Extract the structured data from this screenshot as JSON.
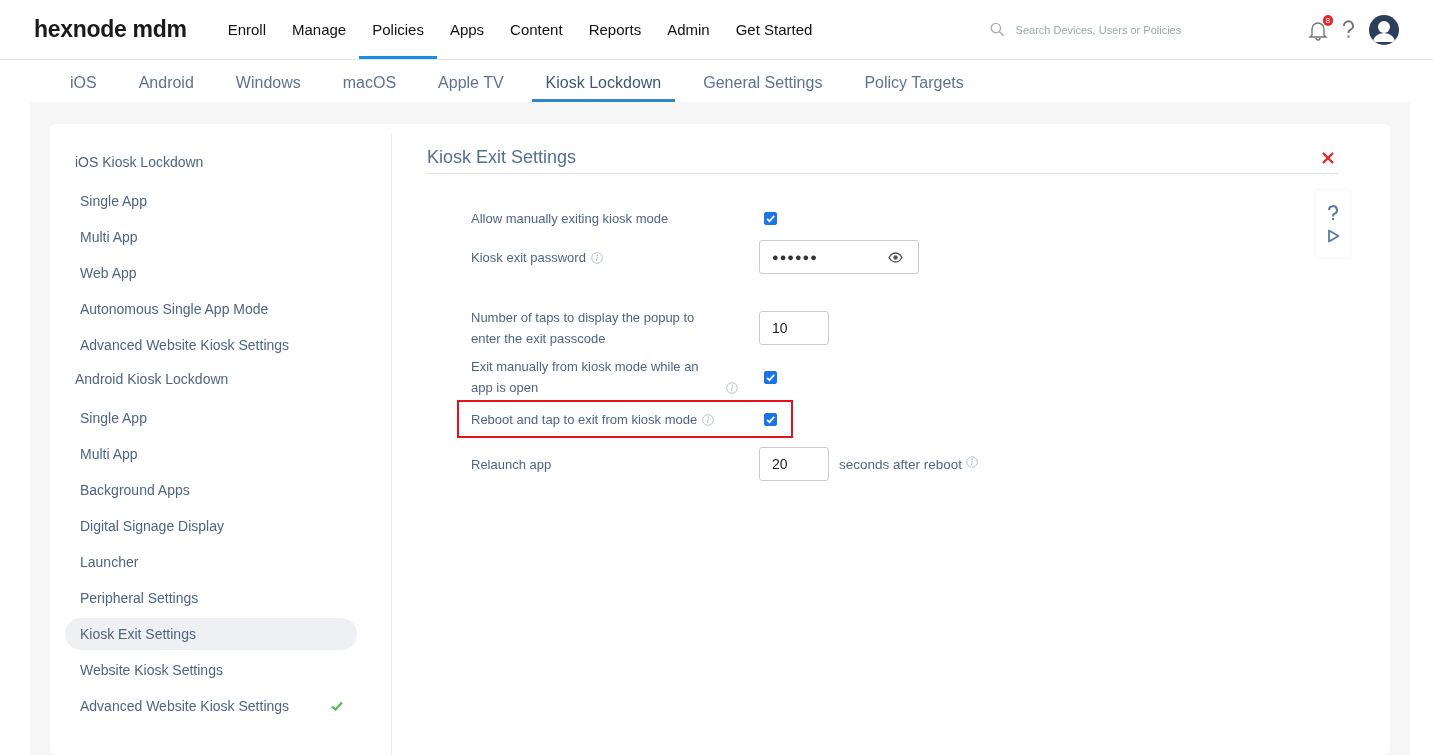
{
  "header": {
    "logo": "hexnode mdm",
    "nav": [
      {
        "label": "Enroll",
        "selected": false
      },
      {
        "label": "Manage",
        "selected": false
      },
      {
        "label": "Policies",
        "selected": true
      },
      {
        "label": "Apps",
        "selected": false
      },
      {
        "label": "Content",
        "selected": false
      },
      {
        "label": "Reports",
        "selected": false
      },
      {
        "label": "Admin",
        "selected": false
      },
      {
        "label": "Get Started",
        "selected": false
      }
    ],
    "search": {
      "placeholder": "Search Devices, Users or Policies"
    },
    "notification_count": "8"
  },
  "tabs": [
    {
      "label": "iOS",
      "selected": false
    },
    {
      "label": "Android",
      "selected": false
    },
    {
      "label": "Windows",
      "selected": false
    },
    {
      "label": "macOS",
      "selected": false
    },
    {
      "label": "Apple TV",
      "selected": false
    },
    {
      "label": "Kiosk Lockdown",
      "selected": true
    },
    {
      "label": "General Settings",
      "selected": false
    },
    {
      "label": "Policy Targets",
      "selected": false
    }
  ],
  "sidebar": {
    "groups": [
      {
        "title": "iOS Kiosk Lockdown",
        "items": [
          {
            "label": "Single App",
            "selected": false,
            "configured": false
          },
          {
            "label": "Multi App",
            "selected": false,
            "configured": false
          },
          {
            "label": "Web App",
            "selected": false,
            "configured": false
          },
          {
            "label": "Autonomous Single App Mode",
            "selected": false,
            "configured": false
          },
          {
            "label": "Advanced Website Kiosk Settings",
            "selected": false,
            "configured": false
          }
        ]
      },
      {
        "title": "Android Kiosk Lockdown",
        "items": [
          {
            "label": "Single App",
            "selected": false,
            "configured": false
          },
          {
            "label": "Multi App",
            "selected": false,
            "configured": false
          },
          {
            "label": "Background Apps",
            "selected": false,
            "configured": false
          },
          {
            "label": "Digital Signage Display",
            "selected": false,
            "configured": false
          },
          {
            "label": "Launcher",
            "selected": false,
            "configured": false
          },
          {
            "label": "Peripheral Settings",
            "selected": false,
            "configured": false
          },
          {
            "label": "Kiosk Exit Settings",
            "selected": true,
            "configured": false
          },
          {
            "label": "Website Kiosk Settings",
            "selected": false,
            "configured": false
          },
          {
            "label": "Advanced Website Kiosk Settings",
            "selected": false,
            "configured": true
          }
        ]
      }
    ]
  },
  "panel": {
    "title": "Kiosk Exit Settings",
    "settings": [
      {
        "kind": "checkbox",
        "label": "Allow manually exiting kiosk mode",
        "info": false,
        "checked": true,
        "highlighted": false
      },
      {
        "kind": "password",
        "label": "Kiosk exit password",
        "info": true,
        "value": "●●●●●●",
        "highlighted": false
      },
      {
        "kind": "number",
        "label": "Number of taps to display the popup to enter the exit passcode",
        "info": false,
        "value": "10",
        "highlighted": false
      },
      {
        "kind": "checkbox",
        "label": "Exit manually from kiosk mode while an app is open",
        "info": true,
        "checked": true,
        "highlighted": false
      },
      {
        "kind": "checkbox",
        "label": "Reboot and tap to exit from kiosk mode",
        "info": true,
        "checked": true,
        "highlighted": true
      },
      {
        "kind": "number",
        "label": "Relaunch app",
        "info": false,
        "value": "20",
        "suffix": "seconds after reboot",
        "suffix_info": true,
        "highlighted": false
      }
    ]
  }
}
